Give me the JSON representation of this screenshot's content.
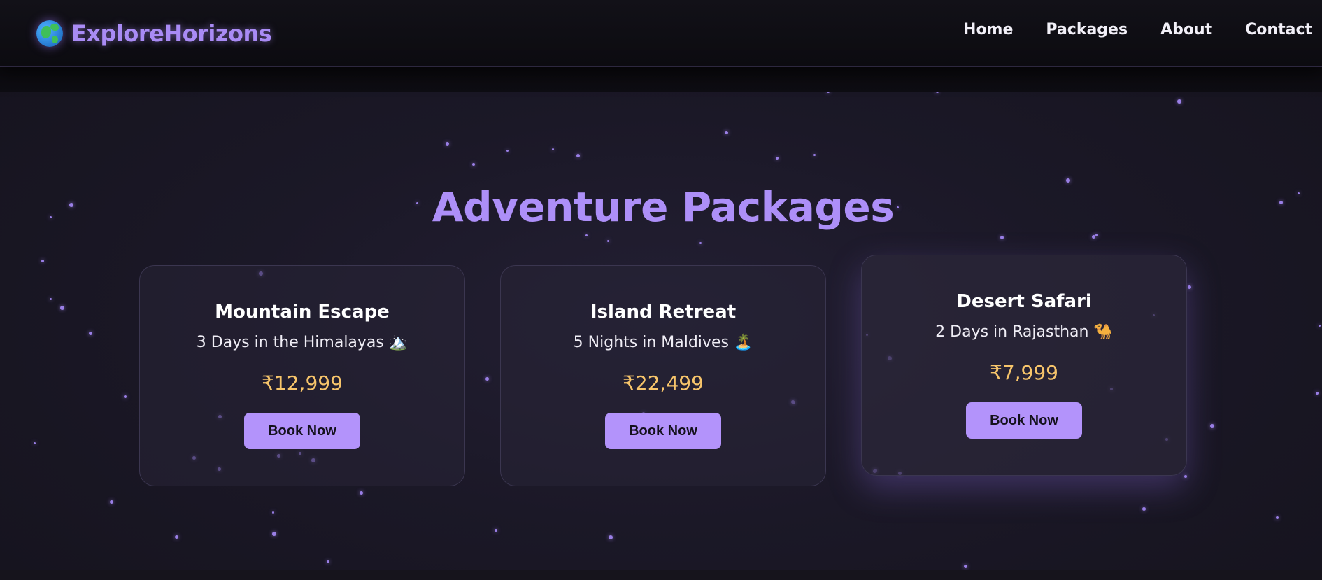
{
  "brand": {
    "name": "ExploreHorizons",
    "icon": "globe-icon"
  },
  "nav": {
    "links": [
      "Home",
      "Packages",
      "About",
      "Contact"
    ]
  },
  "section": {
    "title": "Adventure Packages"
  },
  "packages": [
    {
      "title": "Mountain Escape",
      "description": "3 Days in the Himalayas 🏔️",
      "price": "₹12,999",
      "button": "Book Now"
    },
    {
      "title": "Island Retreat",
      "description": "5 Nights in Maldives 🏝️",
      "price": "₹22,499",
      "button": "Book Now"
    },
    {
      "title": "Desert Safari",
      "description": "2 Days in Rajasthan 🐪",
      "price": "₹7,999",
      "button": "Book Now"
    }
  ],
  "colors": {
    "accent": "#b393fb",
    "brand": "#a98bf5",
    "price": "#f7c56b",
    "background": "#1b1827"
  }
}
